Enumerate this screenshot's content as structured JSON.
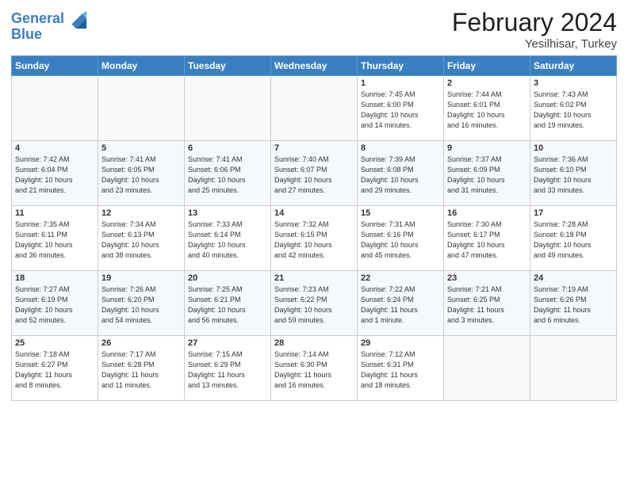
{
  "header": {
    "logo_line1": "General",
    "logo_line2": "Blue",
    "title": "February 2024",
    "subtitle": "Yesilhisar, Turkey"
  },
  "days_of_week": [
    "Sunday",
    "Monday",
    "Tuesday",
    "Wednesday",
    "Thursday",
    "Friday",
    "Saturday"
  ],
  "weeks": [
    [
      {
        "day": "",
        "info": ""
      },
      {
        "day": "",
        "info": ""
      },
      {
        "day": "",
        "info": ""
      },
      {
        "day": "",
        "info": ""
      },
      {
        "day": "1",
        "info": "Sunrise: 7:45 AM\nSunset: 6:00 PM\nDaylight: 10 hours\nand 14 minutes."
      },
      {
        "day": "2",
        "info": "Sunrise: 7:44 AM\nSunset: 6:01 PM\nDaylight: 10 hours\nand 16 minutes."
      },
      {
        "day": "3",
        "info": "Sunrise: 7:43 AM\nSunset: 6:02 PM\nDaylight: 10 hours\nand 19 minutes."
      }
    ],
    [
      {
        "day": "4",
        "info": "Sunrise: 7:42 AM\nSunset: 6:04 PM\nDaylight: 10 hours\nand 21 minutes."
      },
      {
        "day": "5",
        "info": "Sunrise: 7:41 AM\nSunset: 6:05 PM\nDaylight: 10 hours\nand 23 minutes."
      },
      {
        "day": "6",
        "info": "Sunrise: 7:41 AM\nSunset: 6:06 PM\nDaylight: 10 hours\nand 25 minutes."
      },
      {
        "day": "7",
        "info": "Sunrise: 7:40 AM\nSunset: 6:07 PM\nDaylight: 10 hours\nand 27 minutes."
      },
      {
        "day": "8",
        "info": "Sunrise: 7:39 AM\nSunset: 6:08 PM\nDaylight: 10 hours\nand 29 minutes."
      },
      {
        "day": "9",
        "info": "Sunrise: 7:37 AM\nSunset: 6:09 PM\nDaylight: 10 hours\nand 31 minutes."
      },
      {
        "day": "10",
        "info": "Sunrise: 7:36 AM\nSunset: 6:10 PM\nDaylight: 10 hours\nand 33 minutes."
      }
    ],
    [
      {
        "day": "11",
        "info": "Sunrise: 7:35 AM\nSunset: 6:11 PM\nDaylight: 10 hours\nand 36 minutes."
      },
      {
        "day": "12",
        "info": "Sunrise: 7:34 AM\nSunset: 6:13 PM\nDaylight: 10 hours\nand 38 minutes."
      },
      {
        "day": "13",
        "info": "Sunrise: 7:33 AM\nSunset: 6:14 PM\nDaylight: 10 hours\nand 40 minutes."
      },
      {
        "day": "14",
        "info": "Sunrise: 7:32 AM\nSunset: 6:15 PM\nDaylight: 10 hours\nand 42 minutes."
      },
      {
        "day": "15",
        "info": "Sunrise: 7:31 AM\nSunset: 6:16 PM\nDaylight: 10 hours\nand 45 minutes."
      },
      {
        "day": "16",
        "info": "Sunrise: 7:30 AM\nSunset: 6:17 PM\nDaylight: 10 hours\nand 47 minutes."
      },
      {
        "day": "17",
        "info": "Sunrise: 7:28 AM\nSunset: 6:18 PM\nDaylight: 10 hours\nand 49 minutes."
      }
    ],
    [
      {
        "day": "18",
        "info": "Sunrise: 7:27 AM\nSunset: 6:19 PM\nDaylight: 10 hours\nand 52 minutes."
      },
      {
        "day": "19",
        "info": "Sunrise: 7:26 AM\nSunset: 6:20 PM\nDaylight: 10 hours\nand 54 minutes."
      },
      {
        "day": "20",
        "info": "Sunrise: 7:25 AM\nSunset: 6:21 PM\nDaylight: 10 hours\nand 56 minutes."
      },
      {
        "day": "21",
        "info": "Sunrise: 7:23 AM\nSunset: 6:22 PM\nDaylight: 10 hours\nand 59 minutes."
      },
      {
        "day": "22",
        "info": "Sunrise: 7:22 AM\nSunset: 6:24 PM\nDaylight: 11 hours\nand 1 minute."
      },
      {
        "day": "23",
        "info": "Sunrise: 7:21 AM\nSunset: 6:25 PM\nDaylight: 11 hours\nand 3 minutes."
      },
      {
        "day": "24",
        "info": "Sunrise: 7:19 AM\nSunset: 6:26 PM\nDaylight: 11 hours\nand 6 minutes."
      }
    ],
    [
      {
        "day": "25",
        "info": "Sunrise: 7:18 AM\nSunset: 6:27 PM\nDaylight: 11 hours\nand 8 minutes."
      },
      {
        "day": "26",
        "info": "Sunrise: 7:17 AM\nSunset: 6:28 PM\nDaylight: 11 hours\nand 11 minutes."
      },
      {
        "day": "27",
        "info": "Sunrise: 7:15 AM\nSunset: 6:29 PM\nDaylight: 11 hours\nand 13 minutes."
      },
      {
        "day": "28",
        "info": "Sunrise: 7:14 AM\nSunset: 6:30 PM\nDaylight: 11 hours\nand 16 minutes."
      },
      {
        "day": "29",
        "info": "Sunrise: 7:12 AM\nSunset: 6:31 PM\nDaylight: 11 hours\nand 18 minutes."
      },
      {
        "day": "",
        "info": ""
      },
      {
        "day": "",
        "info": ""
      }
    ]
  ]
}
